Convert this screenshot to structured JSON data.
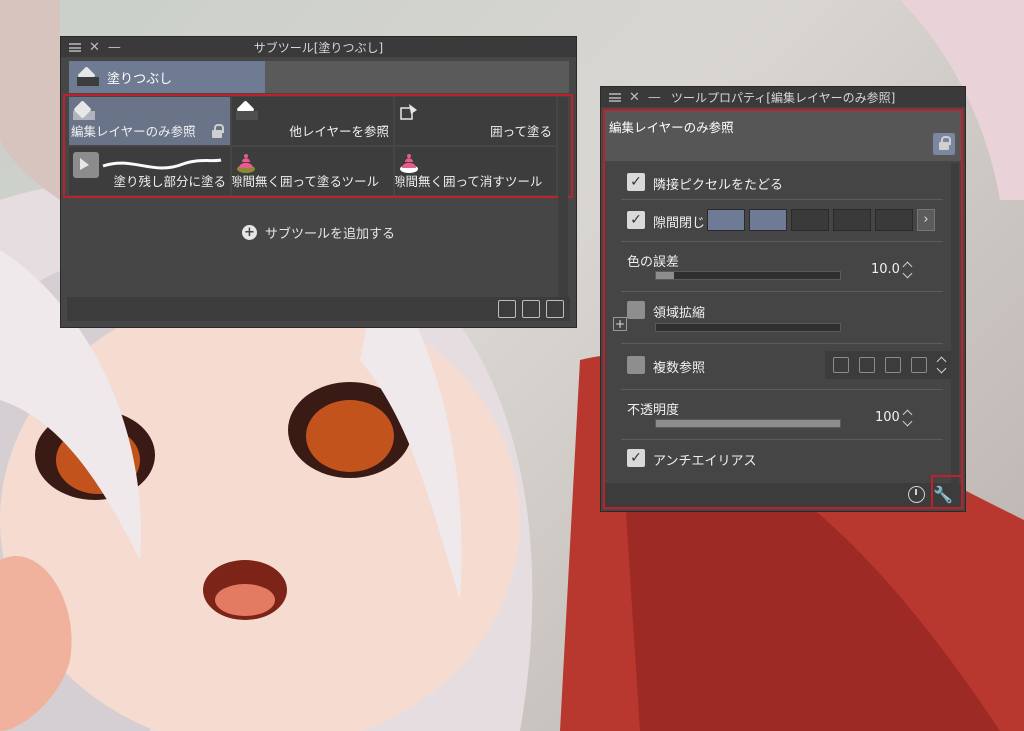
{
  "subtool_panel": {
    "title": "サブツール[塗りつぶし]",
    "group_tab": "塗りつぶし",
    "tools": [
      {
        "label": "編集レイヤーのみ参照",
        "selected": true,
        "locked": true,
        "icon": "paint-bucket-icon"
      },
      {
        "label": "他レイヤーを参照",
        "selected": false,
        "icon": "paint-bucket-icon"
      },
      {
        "label": "囲って塗る",
        "selected": false,
        "icon": "lasso-fill-icon"
      },
      {
        "label": "塗り残し部分に塗る",
        "selected": false,
        "icon": "brush-stroke-icon"
      },
      {
        "label": "隙間無く囲って塗るツール",
        "selected": false,
        "icon": "pink-cake-icon"
      },
      {
        "label": "隙間無く囲って消すツール",
        "selected": false,
        "icon": "pink-cake-icon"
      }
    ],
    "add_subtool_label": "サブツールを追加する"
  },
  "tool_property_panel": {
    "title": "ツールプロパティ[編集レイヤーのみ参照]",
    "tool_name": "編集レイヤーのみ参照",
    "adjacent_pixels": {
      "label": "隣接ピクセルをたどる",
      "checked": true
    },
    "close_gap": {
      "label": "隙間閉じ",
      "checked": true,
      "level": 2,
      "levels_total": 5
    },
    "color_tolerance": {
      "label": "色の誤差",
      "value": "10.0",
      "fraction": 0.1
    },
    "area_scaling": {
      "label": "領域拡縮",
      "checked": false
    },
    "multi_reference": {
      "label": "複数参照",
      "checked": false
    },
    "opacity": {
      "label": "不透明度",
      "value": "100",
      "fraction": 1.0
    },
    "antialiasing": {
      "label": "アンチエイリアス",
      "checked": true
    }
  },
  "colors": {
    "highlight": "#c0202a",
    "selected_tab": "#6f7b92",
    "panel_bg": "#464646"
  }
}
